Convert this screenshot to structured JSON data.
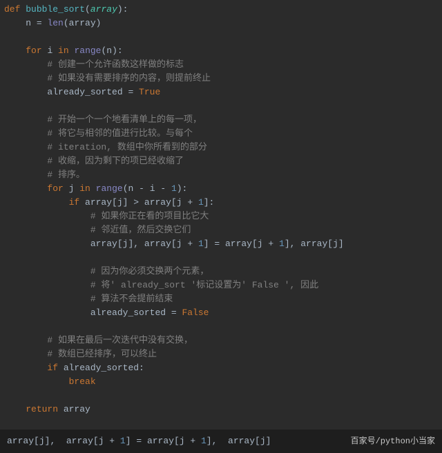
{
  "code": {
    "l1_def": "def ",
    "l1_fn": "bubble_sort",
    "l1_lp": "(",
    "l1_arr": "array",
    "l1_rp": "):",
    "l2_n": "n",
    "l2_eq": " = ",
    "l2_len": "len",
    "l2_lp": "(",
    "l2_arr": "array",
    "l2_rp": ")",
    "l4_for": "for ",
    "l4_i": "i",
    "l4_in": " in ",
    "l4_range": "range",
    "l4_lp": "(",
    "l4_n": "n",
    "l4_rp": "):",
    "l5_c": "# 创建一个允许函数这样做的标志",
    "l6_c": "# 如果没有需要排序的内容，则提前终止",
    "l7_as": "already_sorted",
    "l7_eq": " = ",
    "l7_true": "True",
    "l9_c": "# 开始一个一个地看清单上的每一项，",
    "l10_c": "# 将它与相邻的值进行比较。与每个",
    "l11_c": "# iteration, 数组中你所看到的部分",
    "l12_c": "# 收缩，因为剩下的项已经收缩了",
    "l13_c": "# 排序。",
    "l14_for": "for ",
    "l14_j": "j",
    "l14_in": " in ",
    "l14_range": "range",
    "l14_lp": "(",
    "l14_n": "n",
    "l14_m1": " - ",
    "l14_i": "i",
    "l14_m2": " - ",
    "l14_1": "1",
    "l14_rp": "):",
    "l15_if": "if ",
    "l15_arr1": "array",
    "l15_lb1": "[",
    "l15_j1": "j",
    "l15_rb1": "]",
    "l15_gt": " > ",
    "l15_arr2": "array",
    "l15_lb2": "[",
    "l15_j2": "j",
    "l15_p": " + ",
    "l15_1": "1",
    "l15_rb2": "]:",
    "l16_c": "# 如果你正在看的项目比它大",
    "l17_c": "# 邻近值，然后交换它们",
    "l18_a1": "array",
    "l18_lb1": "[",
    "l18_j1": "j",
    "l18_rb1": "]",
    "l18_c1": ", ",
    "l18_a2": "array",
    "l18_lb2": "[",
    "l18_j2": "j",
    "l18_p1": " + ",
    "l18_n1": "1",
    "l18_rb2": "]",
    "l18_eq": " = ",
    "l18_a3": "array",
    "l18_lb3": "[",
    "l18_j3": "j",
    "l18_p2": " + ",
    "l18_n2": "1",
    "l18_rb3": "]",
    "l18_c2": ", ",
    "l18_a4": "array",
    "l18_lb4": "[",
    "l18_j4": "j",
    "l18_rb4": "]",
    "l20_c": "# 因为你必须交换两个元素，",
    "l21_c": "# 将' already_sort '标记设置为' False ', 因此",
    "l22_c": "# 算法不会提前结束",
    "l23_as": "already_sorted",
    "l23_eq": " = ",
    "l23_false": "False",
    "l25_c": "# 如果在最后一次迭代中没有交换，",
    "l26_c": "# 数组已经排序，可以终止",
    "l27_if": "if ",
    "l27_as": "already_sorted",
    "l27_col": ":",
    "l28_break": "break",
    "l30_ret": "return ",
    "l30_arr": "array"
  },
  "bottom": {
    "a1": "array",
    "lb1": "[",
    "j1": "j",
    "rb1": "]",
    "c1": ",  ",
    "a2": "array",
    "lb2": "[",
    "j2": "j",
    "p1": " + ",
    "n1": "1",
    "rb2": "]",
    "eq": " = ",
    "a3": "array",
    "lb3": "[",
    "j3": "j",
    "p2": " + ",
    "n2": "1",
    "rb3": "]",
    "c2": ",  ",
    "a4": "array",
    "lb4": "[",
    "j4": "j",
    "rb4": "]",
    "attrib": "百家号/python小当家"
  }
}
